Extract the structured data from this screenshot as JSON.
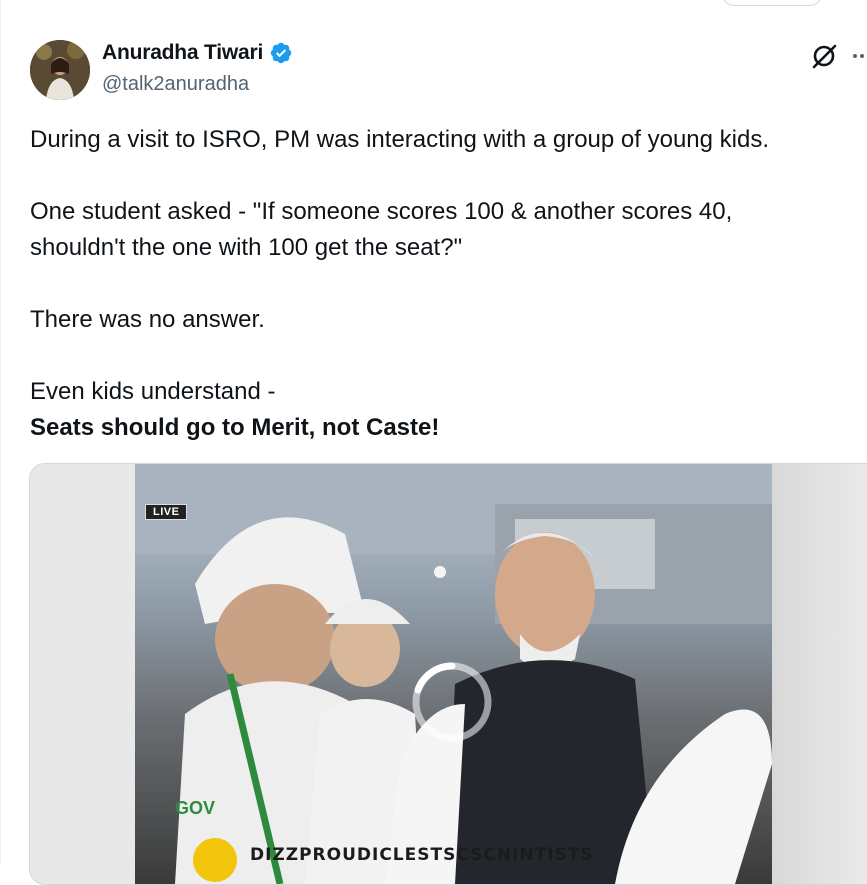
{
  "author": {
    "display_name": "Anuradha Tiwari",
    "handle": "@talk2anuradha"
  },
  "icons": {
    "verified": "verified-badge-icon",
    "grok": "grok-icon",
    "more": "more-horizontal-icon",
    "play": "loading-ring-icon"
  },
  "colors": {
    "verified": "#1d9bf0",
    "text": "#0f1419",
    "secondary": "#536471"
  },
  "tweet": {
    "line1": "During a visit to ISRO, PM was interacting with a group of young kids.",
    "line2": "One student asked - \"If someone scores 100 & another scores 40,",
    "line3": "shouldn't the one with 100 get the seat?\"",
    "line4": "There was no answer.",
    "line5": "Even kids understand -",
    "line6": "Seats should go to Merit, not Caste!"
  },
  "media": {
    "live_badge": "LIVE",
    "ticker_text": "DIZZPROUDICLESTSCSCNINTISTS"
  }
}
